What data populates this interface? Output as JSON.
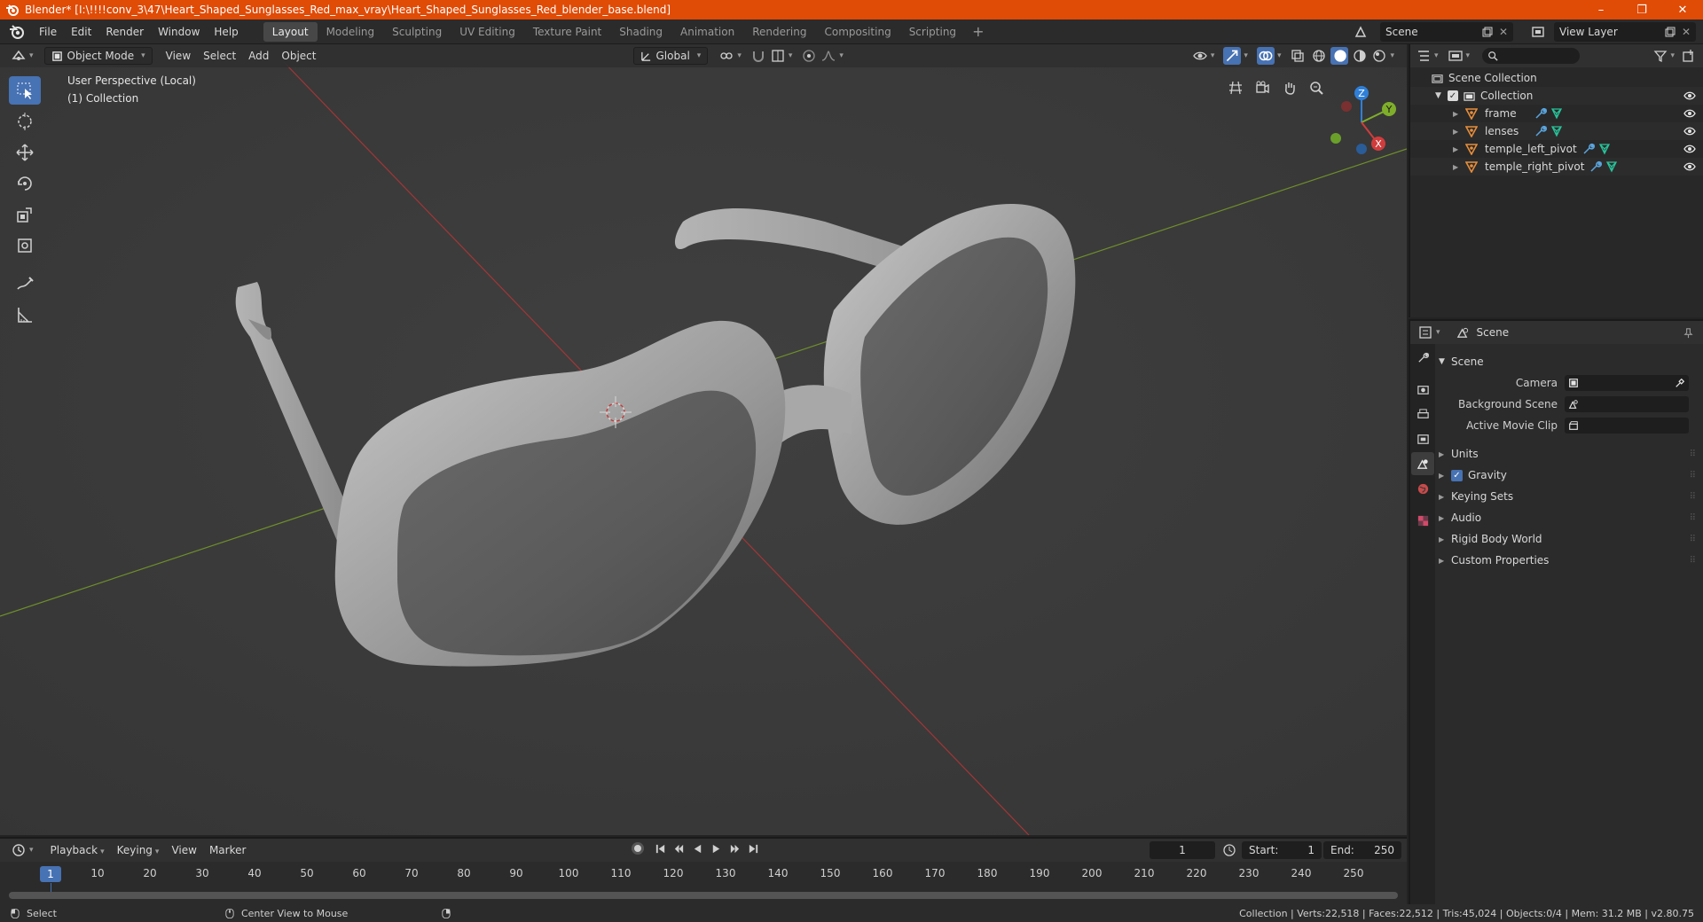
{
  "window": {
    "title": "Blender* [I:\\!!!!conv_3\\47\\Heart_Shaped_Sunglasses_Red_max_vray\\Heart_Shaped_Sunglasses_Red_blender_base.blend]",
    "minimize": "–",
    "maximize": "❐",
    "close": "✕"
  },
  "menus": [
    "File",
    "Edit",
    "Render",
    "Window",
    "Help"
  ],
  "workspaces": [
    "Layout",
    "Modeling",
    "Sculpting",
    "UV Editing",
    "Texture Paint",
    "Shading",
    "Animation",
    "Rendering",
    "Compositing",
    "Scripting"
  ],
  "workspace_add": "+",
  "scene_selector": {
    "label": "Scene"
  },
  "view_layer_selector": {
    "label": "View Layer"
  },
  "viewport": {
    "mode": "Object Mode",
    "menus": [
      "View",
      "Select",
      "Add",
      "Object"
    ],
    "transform_orientation": "Global",
    "info_line1": "User Perspective (Local)",
    "info_line2": "(1) Collection",
    "gizmo": {
      "x": "X",
      "y": "Y",
      "z": "Z"
    }
  },
  "outliner": {
    "root": "Scene Collection",
    "collection": "Collection",
    "objects": [
      "frame",
      "lenses",
      "temple_left_pivot",
      "temple_right_pivot"
    ]
  },
  "properties": {
    "header": "Scene",
    "panel_title": "Scene",
    "fields": [
      {
        "label": "Camera"
      },
      {
        "label": "Background Scene"
      },
      {
        "label": "Active Movie Clip"
      }
    ],
    "sections": [
      "Units",
      "Gravity",
      "Keying Sets",
      "Audio",
      "Rigid Body World",
      "Custom Properties"
    ],
    "gravity_checked": true
  },
  "timeline": {
    "menus": [
      "Playback",
      "Keying",
      "View",
      "Marker"
    ],
    "current_frame": "1",
    "start_label": "Start:",
    "start": "1",
    "end_label": "End:",
    "end": "250",
    "ticks": [
      "10",
      "20",
      "30",
      "40",
      "50",
      "60",
      "70",
      "80",
      "90",
      "100",
      "110",
      "120",
      "130",
      "140",
      "150",
      "160",
      "170",
      "180",
      "190",
      "200",
      "210",
      "220",
      "230",
      "240",
      "250"
    ],
    "playhead": "1"
  },
  "statusbar": {
    "select": "Select",
    "center_view": "Center View to Mouse",
    "stats": "Collection | Verts:22,518 | Faces:22,512 | Tris:45,024 | Objects:0/4 | Mem: 31.2 MB | v2.80.75"
  },
  "colors": {
    "titlebar": "#e04b06",
    "accent": "#4772b3",
    "x_axis": "#d03c3c",
    "y_axis": "#7fae2a",
    "z_axis": "#2f7fd8",
    "object_icon": "#e88e3a",
    "mesh_data_icon": "#28c39a",
    "modifier_icon": "#5aa6e0"
  }
}
